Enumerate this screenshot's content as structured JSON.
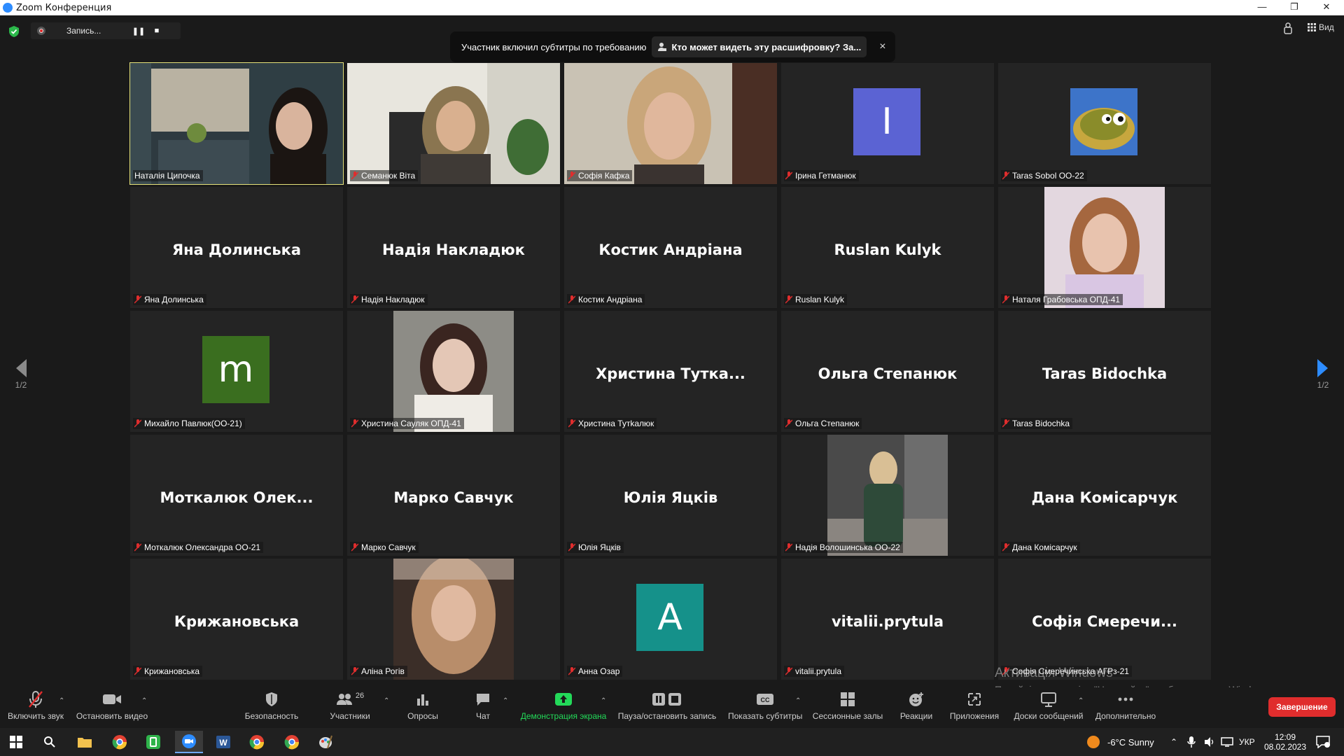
{
  "window": {
    "title": "Zoom Конференция"
  },
  "recording": {
    "label": "Запись...",
    "pause": "❚❚",
    "stop": "■"
  },
  "banner": {
    "text": "Участник включил субтитры по требованию",
    "link": "Кто может видеть эту расшифровку? За...",
    "close": "×"
  },
  "view": {
    "label": "Вид"
  },
  "pager": {
    "left": "1/2",
    "right": "1/2"
  },
  "tiles": [
    {
      "label": "Наталія Ципочка",
      "kind": "video",
      "active": true,
      "muted": false
    },
    {
      "label": "Семанюк  Віта",
      "kind": "video",
      "muted": true
    },
    {
      "label": "Софія Кафка",
      "kind": "video",
      "muted": true
    },
    {
      "label": "Ірина Гетманюк",
      "kind": "avatar",
      "letter": "I",
      "color": "#5b63d3",
      "muted": true
    },
    {
      "label": "Taras Sobol OO-22",
      "kind": "photo",
      "muted": true
    },
    {
      "label": "Яна Долинська",
      "kind": "name",
      "big": "Яна Долинська",
      "muted": true
    },
    {
      "label": "Надія Накладюк",
      "kind": "name",
      "big": "Надія Накладюк",
      "muted": true
    },
    {
      "label": "Костик Андріана",
      "kind": "name",
      "big": "Костик Андріана",
      "muted": true
    },
    {
      "label": "Ruslan Kulyk",
      "kind": "name",
      "big": "Ruslan Kulyk",
      "muted": true
    },
    {
      "label": "Наталя Грабовська ОПД-41",
      "kind": "photo",
      "muted": true
    },
    {
      "label": "Михайло Павлюк(ОО-21)",
      "kind": "avatar",
      "letter": "m",
      "color": "#3a6e1f",
      "muted": true
    },
    {
      "label": "Христина Сауляк ОПД-41",
      "kind": "photo",
      "muted": true
    },
    {
      "label": "Христина Тутkалюк",
      "kind": "name",
      "big": "Христина  Тутка...",
      "muted": true
    },
    {
      "label": "Ольга Степанюк",
      "kind": "name",
      "big": "Ольга Степанюк",
      "muted": true
    },
    {
      "label": "Taras Bidochka",
      "kind": "name",
      "big": "Taras Bidochka",
      "muted": true
    },
    {
      "label": "Моткалюк Олександра ОО-21",
      "kind": "name",
      "big": "Моткалюк  Олек...",
      "muted": true
    },
    {
      "label": "Марко Савчук",
      "kind": "name",
      "big": "Марко Савчук",
      "muted": true
    },
    {
      "label": "Юлія Яцків",
      "kind": "name",
      "big": "Юлія Яцків",
      "muted": true
    },
    {
      "label": "Надія Волошинська ОО-22",
      "kind": "photo",
      "muted": true
    },
    {
      "label": "Дана Комісарчук",
      "kind": "name",
      "big": "Дана Комісарчук",
      "muted": true
    },
    {
      "label": "Крижановська",
      "kind": "name",
      "big": "Крижановська",
      "muted": true
    },
    {
      "label": "Аліна Рогів",
      "kind": "photo",
      "muted": true
    },
    {
      "label": "Анна Озар",
      "kind": "avatar",
      "letter": "A",
      "color": "#15918a",
      "muted": true
    },
    {
      "label": "vitalii.prytula",
      "kind": "name",
      "big": "vitalii.prytula",
      "muted": true
    },
    {
      "label": "Софія Смеречинська АГРз-21",
      "kind": "name",
      "big": "Софія  Смеречи...",
      "muted": true
    }
  ],
  "activation": {
    "title": "Активація Windows",
    "text": "Перейдіть до розділу \"Настройки\", щоб активувати Windows."
  },
  "toolbar": {
    "unmute": "Включить звук",
    "video": "Остановить видео",
    "security": "Безопасность",
    "participants": "Участники",
    "participants_count": "26",
    "polls": "Опросы",
    "chat": "Чат",
    "share": "Демонстрация экрана",
    "record": "Пауза/остановить запись",
    "captions": "Показать субтитры",
    "rooms": "Сессионные залы",
    "reactions": "Реакции",
    "apps": "Приложения",
    "whiteboards": "Доски сообщений",
    "more": "Дополнительно",
    "end": "Завершение"
  },
  "taskbar": {
    "weather": "-6°C  Sunny",
    "lang": "УКР",
    "time": "12:09",
    "date": "08.02.2023"
  },
  "colors": {
    "share_green": "#23d959",
    "end_red": "#e02d2d",
    "active_border": "#e6e27a"
  }
}
